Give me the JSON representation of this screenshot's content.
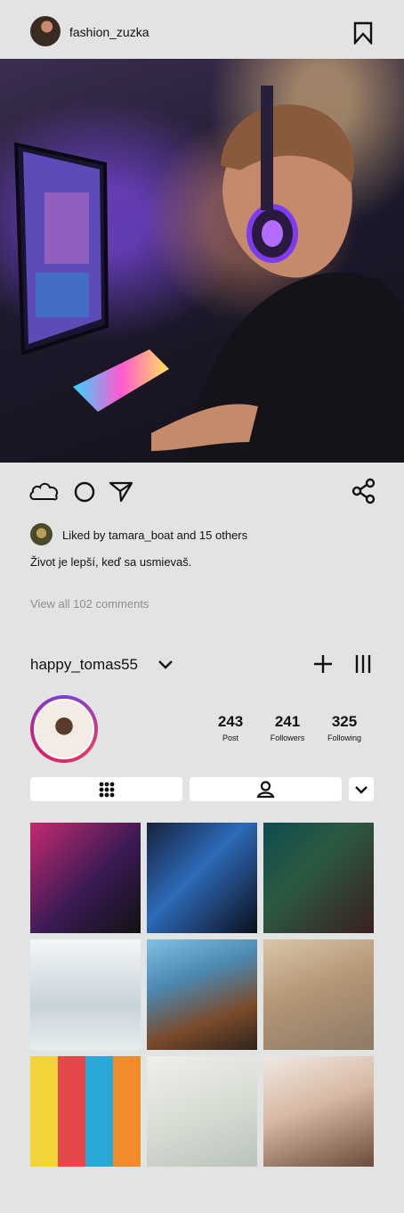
{
  "post": {
    "username": "fashion_zuzka",
    "liked_text": "Liked by tamara_boat and 15 others",
    "caption": "Život je lepší, keď sa usmievaš.",
    "view_comments": "View all 102 comments"
  },
  "profile": {
    "username": "happy_tomas55",
    "stats": {
      "posts_count": "243",
      "posts_label": "Post",
      "followers_count": "241",
      "followers_label": "Followers",
      "following_count": "325",
      "following_label": "Following"
    }
  },
  "icons": {
    "bookmark": "bookmark-icon",
    "like": "cloud-icon",
    "comment": "circle-icon",
    "send": "send-icon",
    "share": "share-icon",
    "add": "plus-icon",
    "menu": "menu-bars-icon",
    "dropdown": "chevron-down-icon",
    "grid_tab": "grid-dots-icon",
    "tagged_tab": "user-icon"
  },
  "colors": {
    "background": "#e2e4e3",
    "text": "#111111",
    "muted": "#8e8e8e",
    "avatar_ring_start": "#7a3ce0",
    "avatar_ring_end": "#e23b6b"
  }
}
